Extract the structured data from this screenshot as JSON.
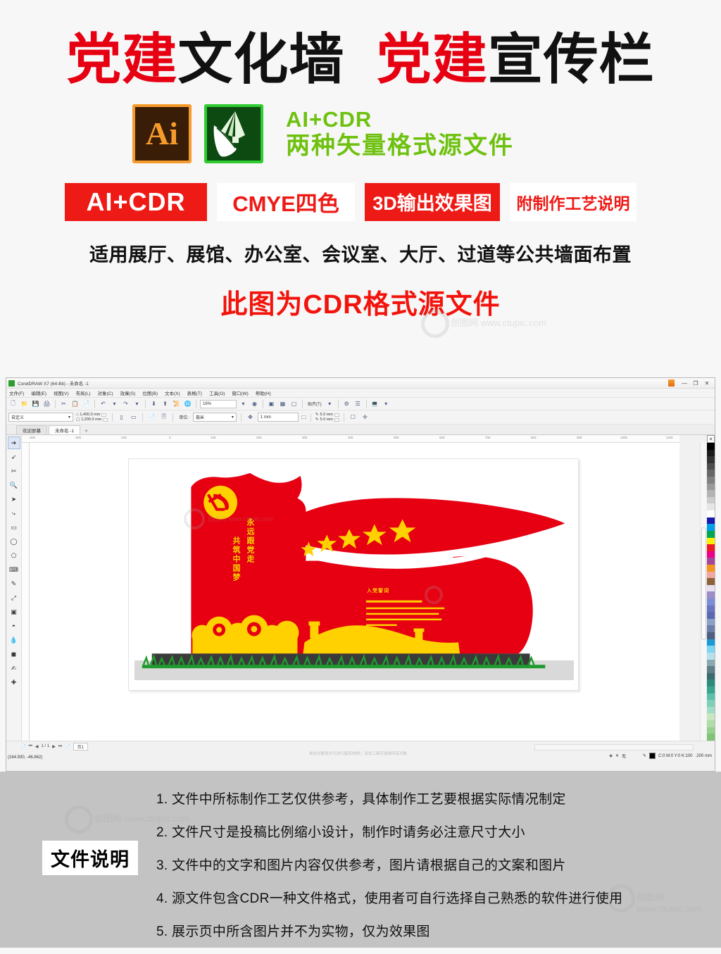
{
  "promo": {
    "title": [
      {
        "text": "党建",
        "color": "red"
      },
      {
        "text": "文化墙",
        "color": "black"
      },
      {
        "text": " ",
        "color": "black"
      },
      {
        "text": "党建",
        "color": "red"
      },
      {
        "text": "宣传栏",
        "color": "black"
      }
    ],
    "title_plain": "党建文化墙 党建宣传栏",
    "logos": {
      "ai_label": "Ai",
      "cdr_label": "coreldraw-balloon-icon",
      "caption_line1": "AI+CDR",
      "caption_line2": "两种矢量格式源文件"
    },
    "badges": [
      {
        "label": "AI+CDR",
        "style": "filled"
      },
      {
        "label": "CMYE四色",
        "style": "outline"
      },
      {
        "label": "3D输出效果图",
        "style": "filled"
      },
      {
        "label": "附制作工艺说明",
        "style": "outline"
      }
    ],
    "applies_text": "适用展厅、展馆、办公室、会议室、大厅、过道等公共墙面布置",
    "format_note": "此图为CDR格式源文件",
    "colors": {
      "red": "#e60012",
      "badge_red": "#ee1a16",
      "green": "#6ec10e",
      "note_red": "#f2140c"
    }
  },
  "app": {
    "title": "CorelDRAW X7 (64-Bit) - 未命名 -1",
    "window_controls": [
      "minimize",
      "restore",
      "close"
    ],
    "menus": [
      "文件(F)",
      "编辑(E)",
      "视图(V)",
      "布局(L)",
      "对象(C)",
      "效果(S)",
      "位图(B)",
      "文本(X)",
      "表格(T)",
      "工具(O)",
      "窗口(W)",
      "帮助(H)"
    ],
    "toolbar": {
      "icons": [
        "new-document-icon",
        "open-icon",
        "save-icon",
        "print-icon",
        "cut-icon",
        "copy-icon",
        "paste-icon",
        "undo-icon",
        "redo-icon",
        "import-icon",
        "export-icon",
        "publish-pdf-icon",
        "zoom-levels-icon",
        "fullscreen-icon",
        "snap-icon",
        "options-icon",
        "app-launcher-icon"
      ],
      "zoom_value": "16%",
      "snap_label": "贴齐(T)"
    },
    "propbar": {
      "preset_name": "自定义",
      "page_width": "1,400.0 mm",
      "page_height": "1,200.0 mm",
      "orientation_icons": [
        "portrait-icon",
        "landscape-icon"
      ],
      "units_label": "单位:",
      "units_value": "毫米",
      "nudge_value": "1 mm",
      "duplicate_x": "5.0 mm",
      "duplicate_y": "5.0 mm"
    },
    "tabs": [
      {
        "label": "欢迎屏幕",
        "active": false
      },
      {
        "label": "未命名 -1",
        "active": true
      }
    ],
    "tab_add": "+",
    "toolbox": [
      "pick-tool-icon",
      "shape-tool-icon",
      "crop-tool-icon",
      "zoom-tool-icon",
      "freehand-tool-icon",
      "smart-fill-icon",
      "rectangle-tool-icon",
      "ellipse-tool-icon",
      "polygon-tool-icon",
      "text-tool-icon",
      "parallel-dimension-icon",
      "straight-line-connector-icon",
      "drop-shadow-icon",
      "transparency-tool-icon",
      "color-eyedropper-icon",
      "interactive-fill-icon",
      "smart-drawing-icon",
      "outline-tool-icon"
    ],
    "ruler": {
      "h_ticks": [
        "-300",
        "-200",
        "-100",
        "0",
        "100",
        "200",
        "300",
        "400",
        "500",
        "600",
        "700",
        "800",
        "900",
        "1000",
        "1100"
      ],
      "v_ticks": [
        "700",
        "600",
        "500",
        "400",
        "300",
        "200",
        "100",
        "0",
        "-100",
        "-200"
      ]
    },
    "statusbar": {
      "page_indicator": "1 / 1",
      "page_tab": "页1",
      "coordinates": "(164.930, -46.862)",
      "fill_label": "无",
      "outline_color": "C:0 M:0 Y:0 K:100",
      "outline_width": ".200 mm",
      "hint": "单击对象两次可进行旋转/倾斜；双击工具可选择所有对象"
    },
    "palette_colors": [
      "#000000",
      "#1a1a1a",
      "#333333",
      "#4d4d4d",
      "#666666",
      "#808080",
      "#999999",
      "#b3b3b3",
      "#cccccc",
      "#e6e6e6",
      "#ffffff",
      "#1a1ab0",
      "#00a0e9",
      "#00a651",
      "#fff200",
      "#ed1c24",
      "#ec008c",
      "#a2489b",
      "#f7941e",
      "#f4a6a0",
      "#8c6239",
      "#e6e0f0",
      "#9e8cc8",
      "#7b8ed4",
      "#6b74c0",
      "#5b69b5",
      "#8aa0c8",
      "#6b7fa8",
      "#4e5f80",
      "#1b9ad6",
      "#7fd4f0",
      "#b8e0ec",
      "#8aa8b0",
      "#5f8088",
      "#3d6b70",
      "#2e8b7a",
      "#3aa58f",
      "#5cbfa8",
      "#7fd0b8",
      "#a0dcc8",
      "#c8e6c0",
      "#b0dca8",
      "#98d090",
      "#80c478"
    ]
  },
  "artwork": {
    "vertical_text_right": "永远跟党走",
    "vertical_text_left": "共筑中国梦",
    "oath_title": "入党誓词",
    "emblem": "party-hammer-sickle-emblem",
    "star_count": 5,
    "colors": {
      "red": "#e60012",
      "gold": "#ffd100",
      "base": "#3a3a3a",
      "grass": "#1f9b2f",
      "ground": "#d9d9d9"
    },
    "elements": [
      "flag-banner",
      "party-emblem",
      "vertical-slogan",
      "five-stars",
      "oath-panel",
      "great-wall-silhouette",
      "auspicious-clouds",
      "grass-strip",
      "stone-base"
    ]
  },
  "description": {
    "label": "文件说明",
    "lines": [
      "1. 文件中所标制作工艺仅供参考，具体制作工艺要根据实际情况制定",
      "2. 文件尺寸是投稿比例缩小设计，制作时请务必注意尺寸大小",
      "3. 文件中的文字和图片内容仅供参考，图片请根据自己的文案和图片",
      "4. 源文件包含CDR一种文件格式，使用者可自行选择自己熟悉的软件进行使用",
      "5. 展示页中所含图片并不为实物，仅为效果图"
    ]
  },
  "watermark": {
    "text": "创图网 www.ctupic.com"
  }
}
